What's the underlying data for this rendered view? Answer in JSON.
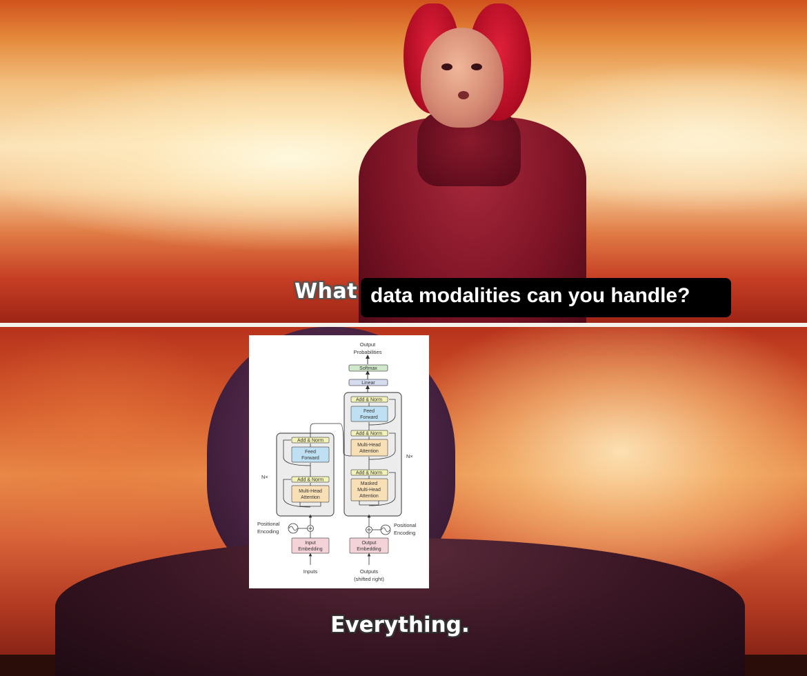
{
  "top_caption": {
    "prefix": "What",
    "boxed_text": "data modalities can you handle?"
  },
  "bottom_caption": "Everything.",
  "diagram": {
    "output_probabilities": [
      "Output",
      "Probabilities"
    ],
    "softmax": "Softmax",
    "linear": "Linear",
    "add_norm": "Add & Norm",
    "feed_forward": [
      "Feed",
      "Forward"
    ],
    "multi_head_attention": [
      "Multi-Head",
      "Attention"
    ],
    "masked_attention": [
      "Masked",
      "Multi-Head",
      "Attention"
    ],
    "nx": "N×",
    "positional_encoding": [
      "Positional",
      "Encoding"
    ],
    "input_embedding": [
      "Input",
      "Embedding"
    ],
    "output_embedding": [
      "Output",
      "Embedding"
    ],
    "inputs": "Inputs",
    "outputs": [
      "Outputs",
      "(shifted right)"
    ]
  },
  "colors": {
    "caption_box": "#000000",
    "softmax": "#cfe8c9",
    "linear": "#d6dcf0",
    "add_norm": "#f3f3b8",
    "feed_forward": "#bfe0f3",
    "attention": "#f9dfb5",
    "embedding": "#f3d3d8",
    "block_bg": "#ececec"
  }
}
